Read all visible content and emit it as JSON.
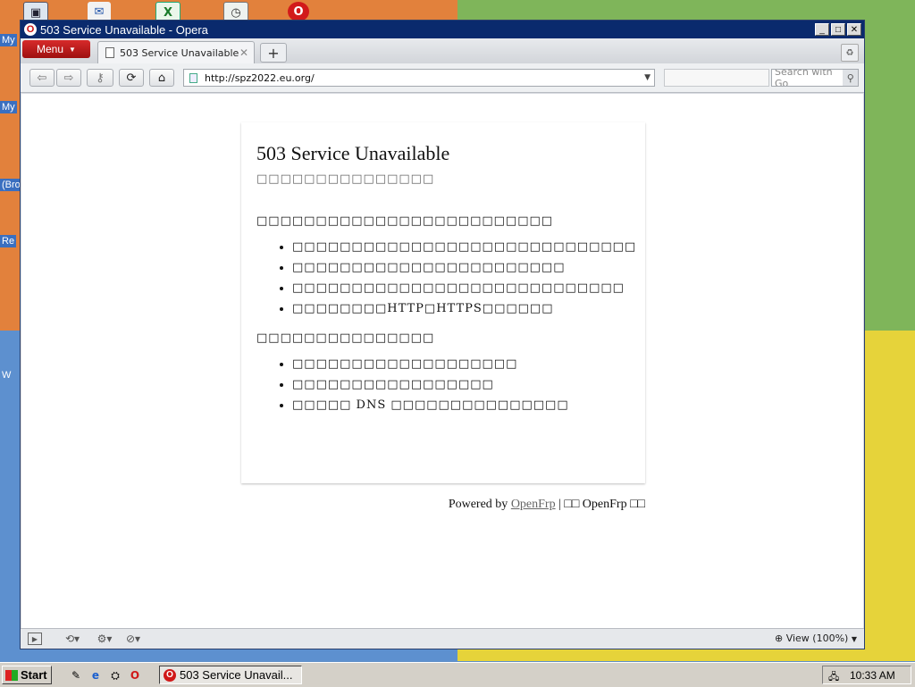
{
  "desktop": {
    "labels": [
      "My",
      "My",
      "(Bro",
      "Re",
      "W"
    ]
  },
  "window": {
    "title": "503 Service Unavailable - Opera",
    "menu_label": "Menu",
    "tab_title": "503 Service Unavailable",
    "url": "http://spz2022.eu.org/",
    "search_placeholder": "Search with Go"
  },
  "page": {
    "title": "503 Service Unavailable",
    "subtitle": "□□□□□□□□□□□□□□□",
    "intro": "□□□□□□□□□□□□□□□□□□□□□□□□□",
    "reasons": [
      "□□□□□□□□□□□□□□□□□□□□□□□□□□□□□",
      "□□□□□□□□□□□□□□□□□□□□□□□",
      "□□□□□□□□□□□□□□□□□□□□□□□□□□□□",
      "□□□□□□□□HTTP□HTTPS□□□□□□"
    ],
    "suggestion_intro": "□□□□□□□□□□□□□□□",
    "suggestions": [
      "□□□□□□□□□□□□□□□□□□□",
      "□□□□□□□□□□□□□□□□□",
      "□□□□□ DNS □□□□□□□□□□□□□□□"
    ],
    "footer_prefix": "Powered by",
    "footer_link": "OpenFrp",
    "footer_suffix": "| □□ OpenFrp □□"
  },
  "statusbar": {
    "zoom_label": "View (100%)"
  },
  "taskbar": {
    "start_label": "Start",
    "task_label": "503 Service Unavail...",
    "clock": "10:33 AM"
  }
}
